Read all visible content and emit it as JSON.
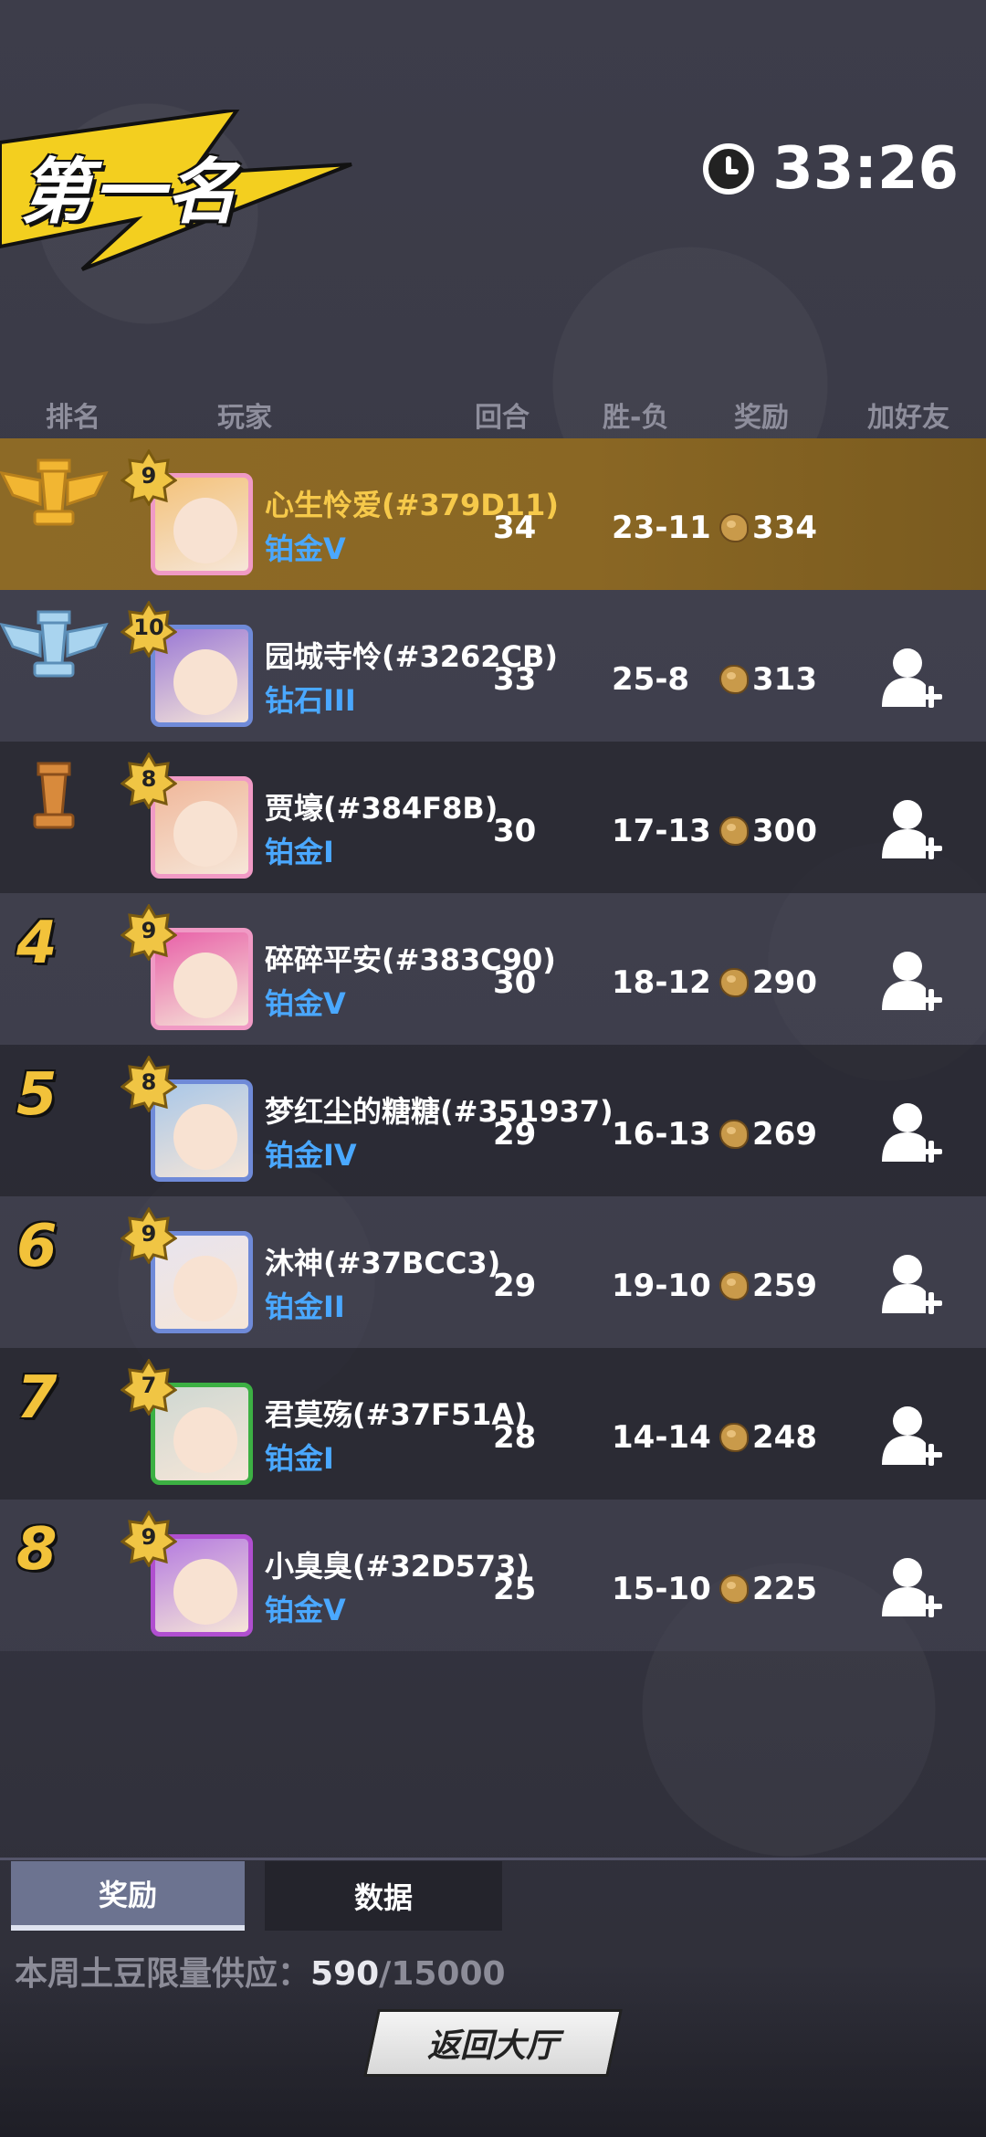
{
  "header": {
    "title": "第一名",
    "timer": "33:26"
  },
  "columns": {
    "rank": "排名",
    "player": "玩家",
    "rounds": "回合",
    "winloss": "胜-负",
    "reward": "奖励",
    "add_friend": "加好友"
  },
  "rows": [
    {
      "rank": "1",
      "rank_icon": "gold-crown-trophy-icon",
      "level": "9",
      "name": "心生怜爱(#379D11)",
      "tier": "铂金V",
      "rounds": "34",
      "winloss": "23-11",
      "reward": "334",
      "avatar_color": "#f3c27a",
      "frame_color": "#f09ac5",
      "show_add": false
    },
    {
      "rank": "2",
      "rank_icon": "silver-crown-trophy-icon",
      "level": "10",
      "name": "园城寺怜(#3262CB)",
      "tier": "钻石III",
      "rounds": "33",
      "winloss": "25-8",
      "reward": "313",
      "avatar_color": "#9a78d6",
      "frame_color": "#6f8ad8",
      "show_add": true
    },
    {
      "rank": "3",
      "rank_icon": "bronze-rook-trophy-icon",
      "level": "8",
      "name": "贾壕(#384F8B)",
      "tier": "铂金I",
      "rounds": "30",
      "winloss": "17-13",
      "reward": "300",
      "avatar_color": "#f0b79a",
      "frame_color": "#f09ac5",
      "show_add": true
    },
    {
      "rank": "4",
      "rank_icon": "",
      "level": "9",
      "name": "碎碎平安(#383C90)",
      "tier": "铂金V",
      "rounds": "30",
      "winloss": "18-12",
      "reward": "290",
      "avatar_color": "#e85fa8",
      "frame_color": "#f09ac5",
      "show_add": true
    },
    {
      "rank": "5",
      "rank_icon": "",
      "level": "8",
      "name": "梦红尘的糖糖(#351937)",
      "tier": "铂金IV",
      "rounds": "29",
      "winloss": "16-13",
      "reward": "269",
      "avatar_color": "#a9c7e8",
      "frame_color": "#6f8ad8",
      "show_add": true
    },
    {
      "rank": "6",
      "rank_icon": "",
      "level": "9",
      "name": "沐神(#37BCC3)",
      "tier": "铂金II",
      "rounds": "29",
      "winloss": "19-10",
      "reward": "259",
      "avatar_color": "#e8e4ee",
      "frame_color": "#6f8ad8",
      "show_add": true
    },
    {
      "rank": "7",
      "rank_icon": "",
      "level": "7",
      "name": "君莫殇(#37F51A)",
      "tier": "铂金I",
      "rounds": "28",
      "winloss": "14-14",
      "reward": "248",
      "avatar_color": "#cfd8d2",
      "frame_color": "#3cb043",
      "show_add": true
    },
    {
      "rank": "8",
      "rank_icon": "",
      "level": "9",
      "name": "小臭臭(#32D573)",
      "tier": "铂金V",
      "rounds": "25",
      "winloss": "15-10",
      "reward": "225",
      "avatar_color": "#b47ae0",
      "frame_color": "#b04fd0",
      "show_add": true
    }
  ],
  "tabs": {
    "rewards": "奖励",
    "data": "数据"
  },
  "supply": {
    "label": "本周土豆限量供应：",
    "current": "590",
    "total": "/15000"
  },
  "back_button": "返回大厅",
  "colors": {
    "highlight": "#8d6a26",
    "tier_blue": "#4aa8ff",
    "rank_gold": "#f2c23a"
  }
}
